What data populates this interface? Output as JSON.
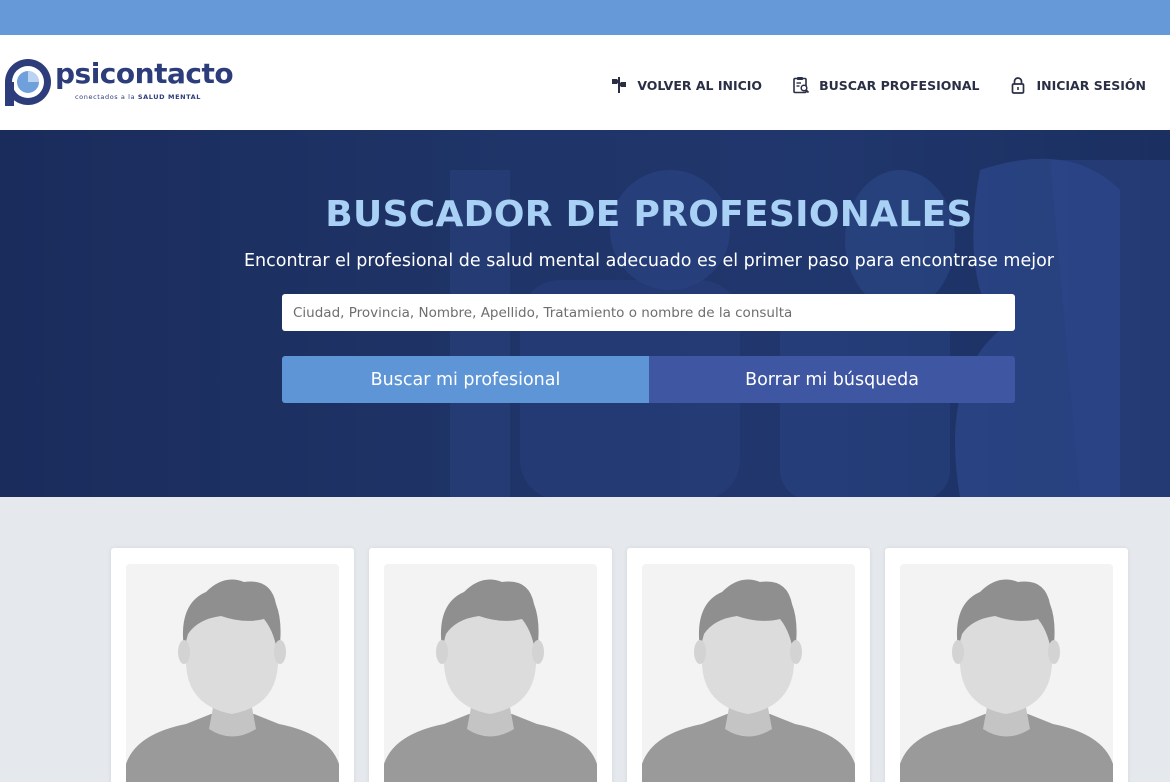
{
  "brand": {
    "name": "psicontacto",
    "tagline_prefix": "conectados a la",
    "tagline_strong": "SALUD MENTAL",
    "primary_color": "#2d3c7a",
    "accent_color": "#6699d8"
  },
  "nav": {
    "items": [
      {
        "label": "VOLVER AL INICIO",
        "icon": "signpost-icon"
      },
      {
        "label": "BUSCAR PROFESIONAL",
        "icon": "clipboard-search-icon"
      },
      {
        "label": "INICIAR SESIÓN",
        "icon": "lock-icon"
      }
    ]
  },
  "hero": {
    "title": "BUSCADOR DE PROFESIONALES",
    "subtitle": "Encontrar el profesional de salud mental adecuado es el primer paso para encontrase mejor",
    "search_placeholder": "Ciudad, Provincia, Nombre, Apellido, Tratamiento o nombre de la consulta",
    "search_value": "",
    "search_button": "Buscar mi profesional",
    "clear_button": "Borrar mi búsqueda",
    "search_button_color": "#5d95d6",
    "clear_button_color": "#3f56a2"
  },
  "professionals": [
    {
      "photo": "avatar-placeholder"
    },
    {
      "photo": "avatar-placeholder"
    },
    {
      "photo": "avatar-placeholder"
    },
    {
      "photo": "avatar-placeholder"
    }
  ]
}
